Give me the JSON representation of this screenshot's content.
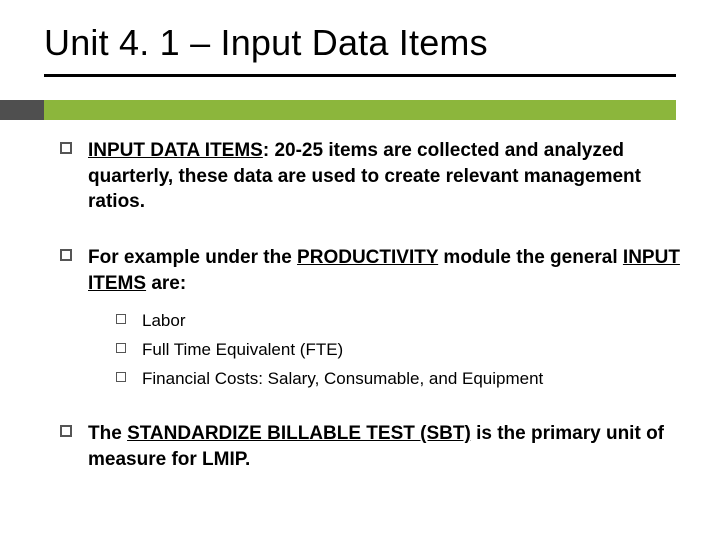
{
  "title": "Unit 4. 1 – Input Data Items",
  "colors": {
    "accent": "#8cb63c",
    "accent_dark": "#4f4f4f"
  },
  "p1": {
    "lead_u": "INPUT DATA ITEMS",
    "lead_rest": ": 20-25 items are collected and analyzed quarterly, these data are used to create relevant management ratios."
  },
  "p2": {
    "pre": "For example under the ",
    "strong_u": "PRODUCTIVITY",
    "mid": " module the general ",
    "tail_u": "INPUT ITEMS",
    "after": " are:"
  },
  "sub": {
    "a": "Labor",
    "b": "Full Time Equivalent (FTE)",
    "c": "Financial Costs: Salary, Consumable, and Equipment"
  },
  "p3": {
    "pre": "The ",
    "strong_u": "STANDARDIZE BILLABLE TEST (SBT)",
    "after": " is the primary unit of measure for LMIP."
  }
}
